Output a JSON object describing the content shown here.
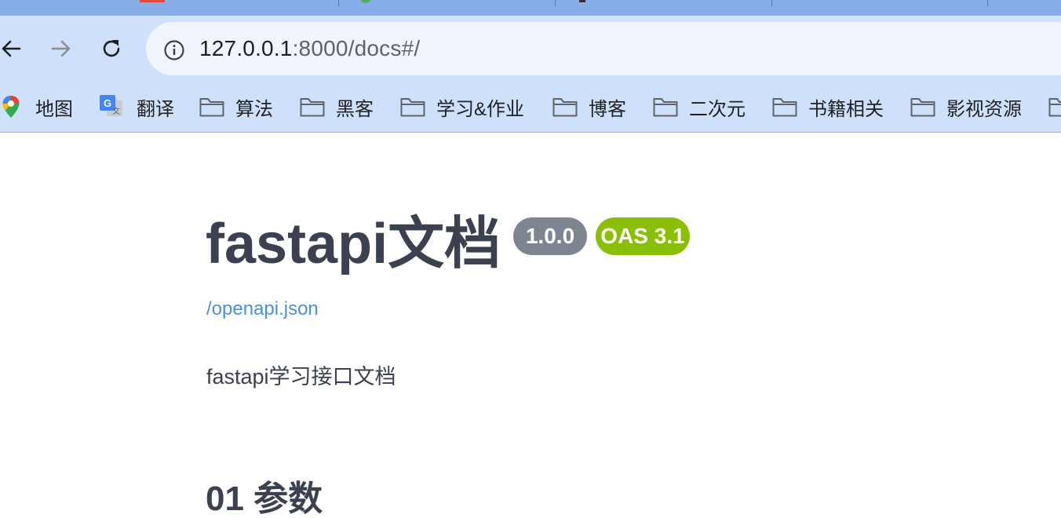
{
  "browser": {
    "url_host": "127.0.0.1",
    "url_path": ":8000/docs#/",
    "bookmarks": [
      {
        "label": "地图",
        "icon": "google-maps-icon"
      },
      {
        "label": "翻译",
        "icon": "google-translate-icon"
      },
      {
        "label": "算法",
        "icon": "folder-icon"
      },
      {
        "label": "黑客",
        "icon": "folder-icon"
      },
      {
        "label": "学习&作业",
        "icon": "folder-icon"
      },
      {
        "label": "博客",
        "icon": "folder-icon"
      },
      {
        "label": "二次元",
        "icon": "folder-icon"
      },
      {
        "label": "书籍相关",
        "icon": "folder-icon"
      },
      {
        "label": "影视资源",
        "icon": "folder-icon"
      }
    ]
  },
  "docs": {
    "title": "fastapi文档",
    "version_badge": "1.0.0",
    "oas_badge": "OAS 3.1",
    "spec_link": "/openapi.json",
    "description": "fastapi学习接口文档",
    "section_heading": "01 参数"
  },
  "colors": {
    "toolbar_bg": "#cfe0fa",
    "tabstrip_bg": "#87aee8",
    "title_text": "#3b4151",
    "link": "#4990e2",
    "version_badge": "#7d8492",
    "oas_badge": "#89bf04"
  }
}
